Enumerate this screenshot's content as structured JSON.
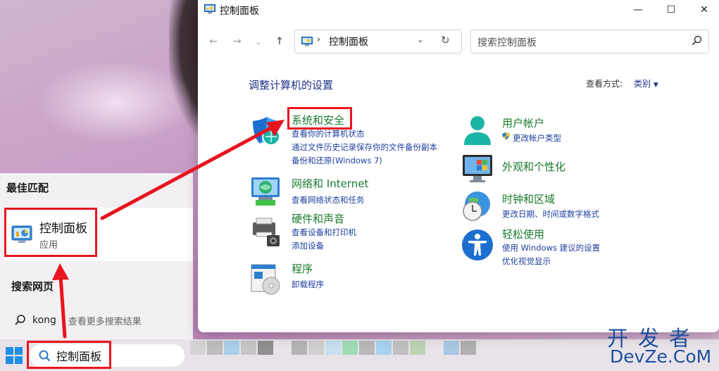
{
  "window": {
    "title": "控制面板",
    "address": "控制面板",
    "search_placeholder": "搜索控制面板",
    "heading": "调整计算机的设置",
    "view_label": "查看方式:",
    "view_value": "类别"
  },
  "categories": [
    {
      "title": "系统和安全",
      "links": [
        "查看你的计算机状态",
        "通过文件历史记录保存你的文件备份副本",
        "备份和还原(Windows 7)"
      ]
    },
    {
      "title": "网络和 Internet",
      "links": [
        "查看网络状态和任务"
      ]
    },
    {
      "title": "硬件和声音",
      "links": [
        "查看设备和打印机",
        "添加设备"
      ]
    },
    {
      "title": "程序",
      "links": [
        "卸载程序"
      ]
    },
    {
      "title": "用户帐户",
      "links": [
        "更改帐户类型"
      ]
    },
    {
      "title": "外观和个性化",
      "links": []
    },
    {
      "title": "时钟和区域",
      "links": [
        "更改日期、时间或数字格式"
      ]
    },
    {
      "title": "轻松使用",
      "links": [
        "使用 Windows 建议的设置",
        "优化视觉显示"
      ]
    }
  ],
  "start_menu": {
    "best_match_heading": "最佳匹配",
    "result_title": "控制面板",
    "result_subtitle": "应用",
    "web_heading": "搜索网页",
    "web_query": "kong",
    "web_hint": "- 查看更多搜索结果"
  },
  "taskbar": {
    "search_text": "控制面板"
  },
  "watermark": {
    "top": "开发者",
    "bottom": "DevZe.CoM"
  },
  "colors": {
    "annotation_red": "#e8141e",
    "category_green": "#1a7a2e",
    "link_blue": "#1e3fa0"
  }
}
